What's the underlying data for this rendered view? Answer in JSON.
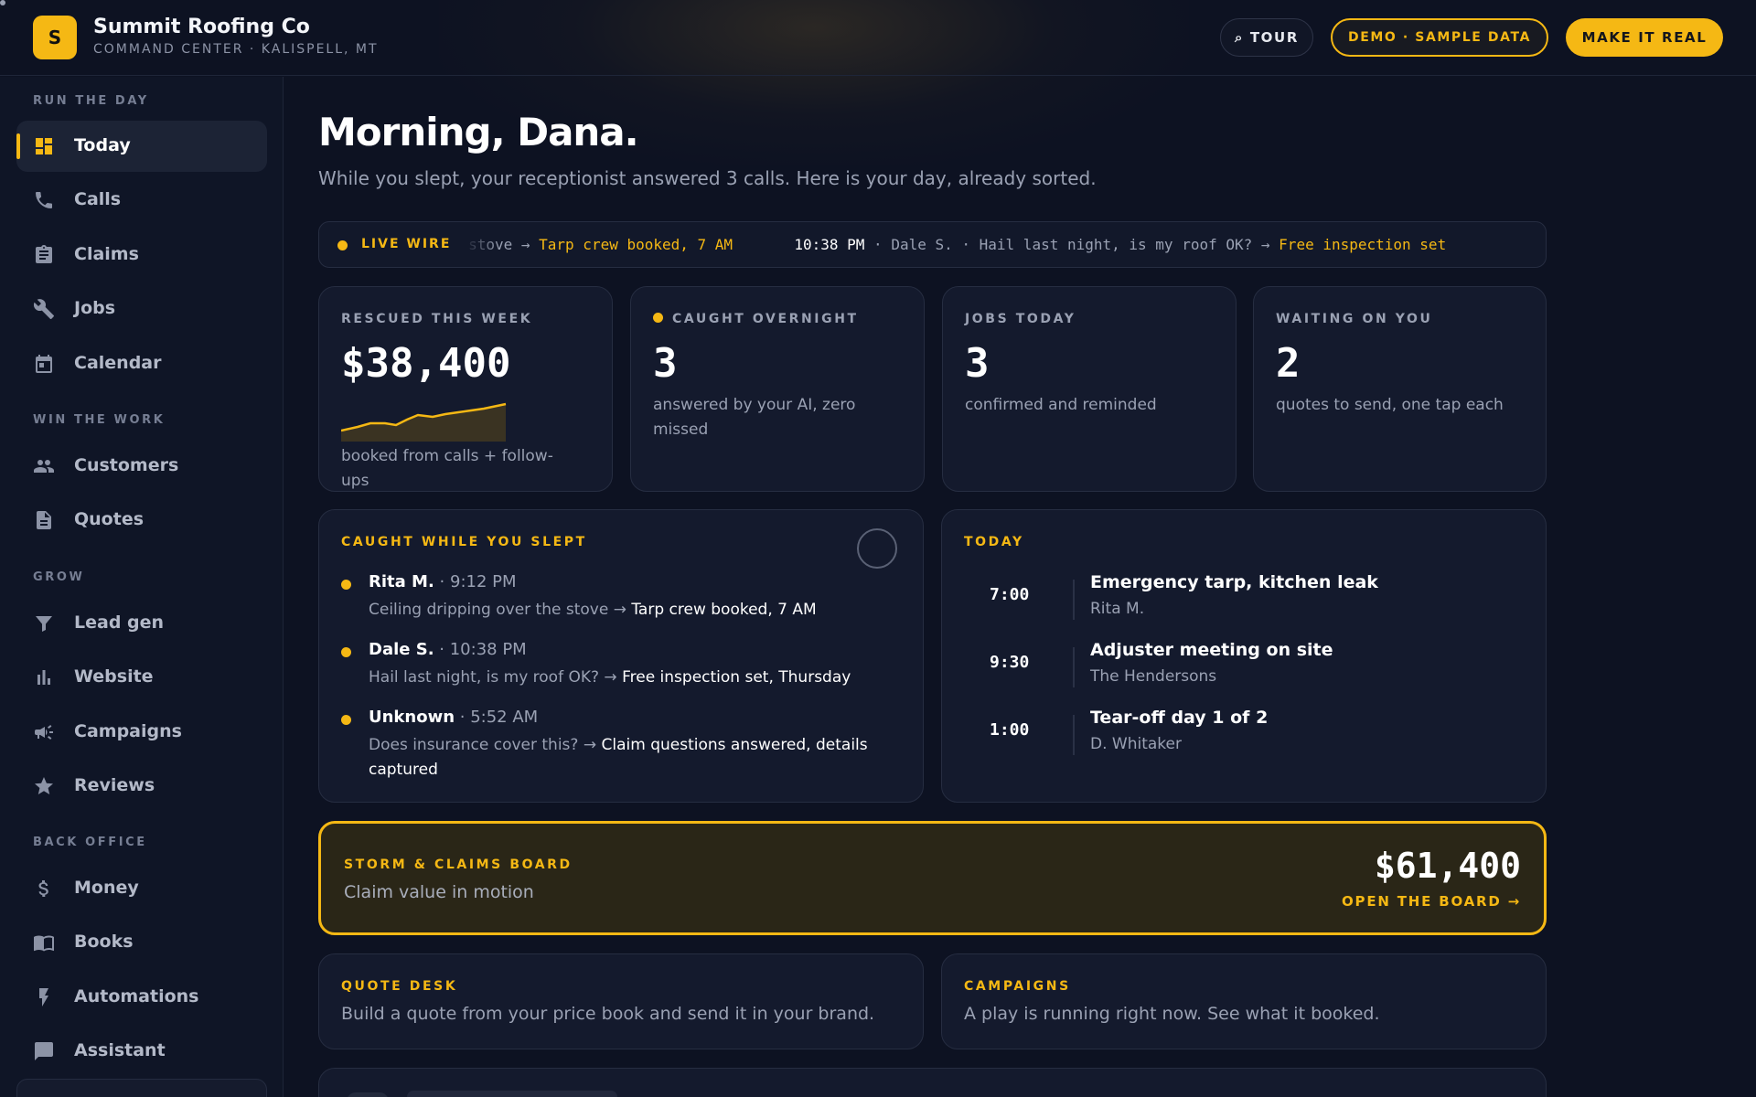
{
  "header": {
    "logo_letter": "S",
    "brand_name": "Summit Roofing Co",
    "brand_sub": "COMMAND CENTER · KALISPELL, MT",
    "tour_label": "⌕ TOUR",
    "demo_label": "DEMO · SAMPLE DATA",
    "real_label": "MAKE IT REAL"
  },
  "sidebar": {
    "sections": [
      "RUN THE DAY",
      "WIN THE WORK",
      "GROW",
      "BACK OFFICE"
    ],
    "items": [
      {
        "label": "Today",
        "icon": "dashboard-icon",
        "active": true
      },
      {
        "label": "Calls",
        "icon": "phone-icon"
      },
      {
        "label": "Claims",
        "icon": "clipboard-icon"
      },
      {
        "label": "Jobs",
        "icon": "wrench-icon"
      },
      {
        "label": "Calendar",
        "icon": "calendar-icon"
      },
      {
        "label": "Customers",
        "icon": "people-icon"
      },
      {
        "label": "Quotes",
        "icon": "document-icon"
      },
      {
        "label": "Lead gen",
        "icon": "funnel-icon"
      },
      {
        "label": "Website",
        "icon": "bar-chart-icon"
      },
      {
        "label": "Campaigns",
        "icon": "megaphone-icon"
      },
      {
        "label": "Reviews",
        "icon": "star-icon"
      },
      {
        "label": "Money",
        "icon": "dollar-icon"
      },
      {
        "label": "Books",
        "icon": "book-icon"
      },
      {
        "label": "Automations",
        "icon": "bolt-icon"
      },
      {
        "label": "Assistant",
        "icon": "chat-icon"
      }
    ]
  },
  "main": {
    "title": "Morning, Dana.",
    "subtitle": "While you slept, your receptionist answered 3 calls. Here is your day, already sorted.",
    "livewire": {
      "label": "LIVE WIRE",
      "entries": [
        {
          "time": "",
          "text": "ver the stove →",
          "outcome": "Tarp crew booked, 7 AM"
        },
        {
          "time": "10:38 PM",
          "text": "· Dale S. · Hail last night, is my roof OK? →",
          "outcome": "Free inspection set"
        }
      ]
    },
    "stats": [
      {
        "label": "RESCUED THIS WEEK",
        "value": "$38,400",
        "desc": "booked from calls + follow-ups"
      },
      {
        "label": "CAUGHT OVERNIGHT",
        "value": "3",
        "desc": "answered by your AI, zero missed"
      },
      {
        "label": "JOBS TODAY",
        "value": "3",
        "desc": "confirmed and reminded"
      },
      {
        "label": "WAITING ON YOU",
        "value": "2",
        "desc": "quotes to send, one tap each"
      }
    ],
    "caught": {
      "title": "CAUGHT WHILE YOU SLEPT",
      "items": [
        {
          "name": "Rita M.",
          "time": "· 9:12 PM",
          "msg": "Ceiling dripping over the stove →",
          "result": "Tarp crew booked, 7 AM"
        },
        {
          "name": "Dale S.",
          "time": "· 10:38 PM",
          "msg": "Hail last night, is my roof OK? →",
          "result": "Free inspection set, Thursday"
        },
        {
          "name": "Unknown",
          "time": "· 5:52 AM",
          "msg": "Does insurance cover this? →",
          "result": "Claim questions answered, details captured"
        }
      ]
    },
    "today": {
      "title": "TODAY",
      "items": [
        {
          "time": "7:00",
          "title": "Emergency tarp, kitchen leak",
          "who": "Rita M."
        },
        {
          "time": "9:30",
          "title": "Adjuster meeting on site",
          "who": "The Hendersons"
        },
        {
          "time": "1:00",
          "title": "Tear-off day 1 of 2",
          "who": "D. Whitaker"
        }
      ]
    },
    "storm": {
      "title": "STORM & CLAIMS BOARD",
      "sub": "Claim value in motion",
      "value": "$61,400",
      "link": "OPEN THE BOARD →"
    },
    "quote_desk": {
      "title": "QUOTE DESK",
      "desc": "Build a quote from your price book and send it in your brand."
    },
    "campaigns": {
      "title": "CAMPAIGNS",
      "desc": "A play is running right now. See what it booked."
    }
  },
  "colors": {
    "accent": "#f5b814",
    "background": "#0d1222",
    "card": "#141a2d"
  }
}
